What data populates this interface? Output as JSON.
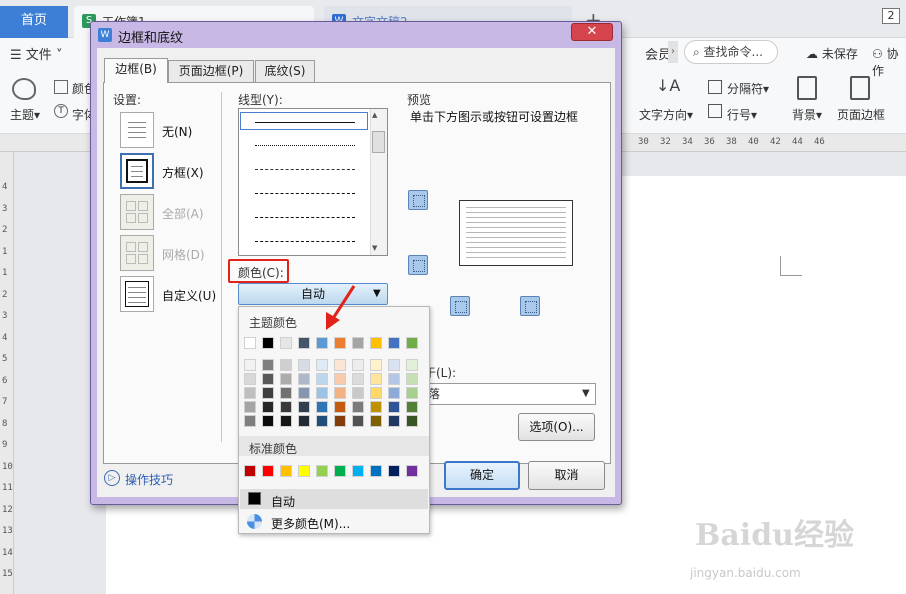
{
  "app": {
    "home_tab": "首页",
    "doc_tabs": [
      {
        "label": "工作簿1",
        "icon": "S"
      },
      {
        "label": "文字文稿2",
        "icon": "W"
      }
    ],
    "window_count": "2",
    "menu": {
      "file": "文件",
      "vip": "会员",
      "search_placeholder": "查找命令...",
      "unsaved": "未保存",
      "collab": "协作"
    },
    "ribbon": {
      "theme": "主题",
      "color": "颜色",
      "font": "字体",
      "text_direction": "文字方向",
      "column_break": "分隔符",
      "line_number": "行号",
      "background": "背景",
      "page_border": "页面边框"
    },
    "ruler_numbers_h": [
      "30",
      "32",
      "34",
      "36",
      "38",
      "40",
      "42",
      "44",
      "46"
    ],
    "ruler_numbers_v": [
      "4",
      "3",
      "2",
      "1",
      "1",
      "2",
      "3",
      "4",
      "5",
      "6",
      "7",
      "8",
      "9",
      "10",
      "11",
      "12",
      "13",
      "14",
      "15"
    ]
  },
  "dialog": {
    "title": "边框和底纹",
    "title_icon": "W",
    "tabs": [
      "边框(B)",
      "页面边框(P)",
      "底纹(S)"
    ],
    "settings_label": "设置:",
    "settings": [
      {
        "label": "无(N)",
        "enabled": true
      },
      {
        "label": "方框(X)",
        "enabled": true
      },
      {
        "label": "全部(A)",
        "enabled": false
      },
      {
        "label": "网格(D)",
        "enabled": false
      },
      {
        "label": "自定义(U)",
        "enabled": true
      }
    ],
    "line_style_label": "线型(Y):",
    "color_label": "颜色(C):",
    "color_value": "自动",
    "preview_label": "预览",
    "preview_hint": "单击下方图示或按钮可设置边框",
    "apply_label": "于(L):",
    "apply_value": "落",
    "options_button": "选项(O)...",
    "tips_link": "操作技巧",
    "ok_button": "确定",
    "cancel_button": "取消"
  },
  "color_dropdown": {
    "theme_label": "主题颜色",
    "theme_top_row": [
      "#ffffff",
      "#000000",
      "#e7e6e6",
      "#44546a",
      "#5b9bd5",
      "#ed7d31",
      "#a5a5a5",
      "#ffc000",
      "#4472c4",
      "#70ad47"
    ],
    "theme_shades": [
      [
        "#f2f2f2",
        "#7f7f7f",
        "#d0cece",
        "#d6dce4",
        "#deebf6",
        "#fbe5d5",
        "#ededed",
        "#fff2cc",
        "#d9e2f3",
        "#e2efd9"
      ],
      [
        "#d8d8d8",
        "#595959",
        "#aeabab",
        "#adb9ca",
        "#bdd7ee",
        "#f7cbac",
        "#dbdbdb",
        "#fee599",
        "#b4c6e7",
        "#c5e0b3"
      ],
      [
        "#bfbfbf",
        "#3f3f3f",
        "#757070",
        "#8496b0",
        "#9cc3e5",
        "#f4b183",
        "#c9c9c9",
        "#ffd965",
        "#8eaadb",
        "#a8d08d"
      ],
      [
        "#a5a5a5",
        "#262626",
        "#3a3838",
        "#323f4f",
        "#2e75b5",
        "#c55a11",
        "#7b7b7b",
        "#bf9000",
        "#2f5496",
        "#538135"
      ],
      [
        "#7f7f7f",
        "#0c0c0c",
        "#171616",
        "#222a35",
        "#1e4e79",
        "#833c0b",
        "#525252",
        "#7f6000",
        "#1f3864",
        "#375623"
      ]
    ],
    "standard_label": "标准颜色",
    "standard_colors": [
      "#c00000",
      "#ff0000",
      "#ffc000",
      "#ffff00",
      "#92d050",
      "#00b050",
      "#00b0f0",
      "#0070c0",
      "#002060",
      "#7030a0"
    ],
    "auto_label": "自动",
    "more_colors_label": "更多颜色(M)..."
  },
  "watermark": {
    "logo": "Baidu经验",
    "url": "jingyan.baidu.com"
  }
}
